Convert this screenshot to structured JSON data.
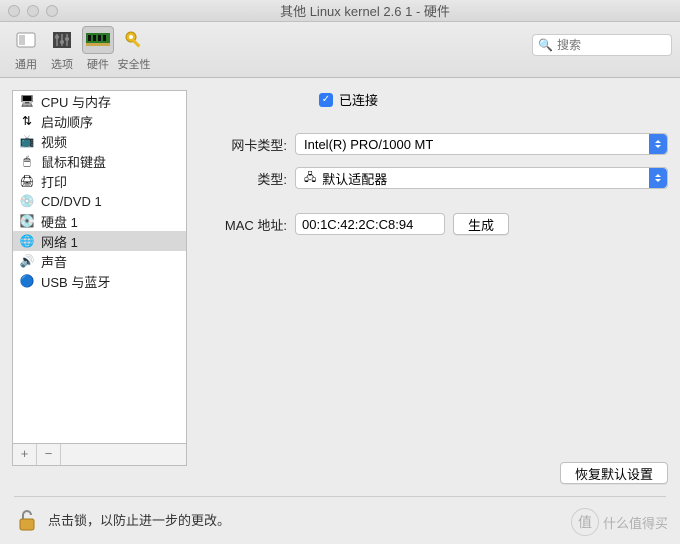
{
  "window": {
    "title": "其他 Linux kernel 2.6 1 - 硬件"
  },
  "toolbar": {
    "items": [
      {
        "label": "通用"
      },
      {
        "label": "选项"
      },
      {
        "label": "硬件"
      },
      {
        "label": "安全性"
      }
    ],
    "search_placeholder": "搜索"
  },
  "sidebar": {
    "items": [
      {
        "icon": "🖥",
        "label": "CPU 与内存"
      },
      {
        "icon": "⇅",
        "label": "启动顺序"
      },
      {
        "icon": "📺",
        "label": "视频"
      },
      {
        "icon": "🖱",
        "label": "鼠标和键盘"
      },
      {
        "icon": "🖨",
        "label": "打印"
      },
      {
        "icon": "💿",
        "label": "CD/DVD 1"
      },
      {
        "icon": "💽",
        "label": "硬盘 1"
      },
      {
        "icon": "🌐",
        "label": "网络 1"
      },
      {
        "icon": "🔊",
        "label": "声音"
      },
      {
        "icon": "🔵",
        "label": "USB 与蓝牙"
      }
    ],
    "selected_index": 7,
    "add": "+",
    "remove": "−"
  },
  "main": {
    "connected_checked": true,
    "connected_label": "已连接",
    "nic_type_label": "网卡类型:",
    "nic_type_value": "Intel(R) PRO/1000 MT",
    "type_label": "类型:",
    "type_value": "默认适配器",
    "mac_label": "MAC 地址:",
    "mac_value": "00:1C:42:2C:C8:94",
    "generate_btn": "生成",
    "restore_btn": "恢复默认设置"
  },
  "lock": {
    "text": "点击锁，以防止进一步的更改。"
  },
  "watermark": {
    "brand": "值",
    "text": "什么值得买"
  }
}
